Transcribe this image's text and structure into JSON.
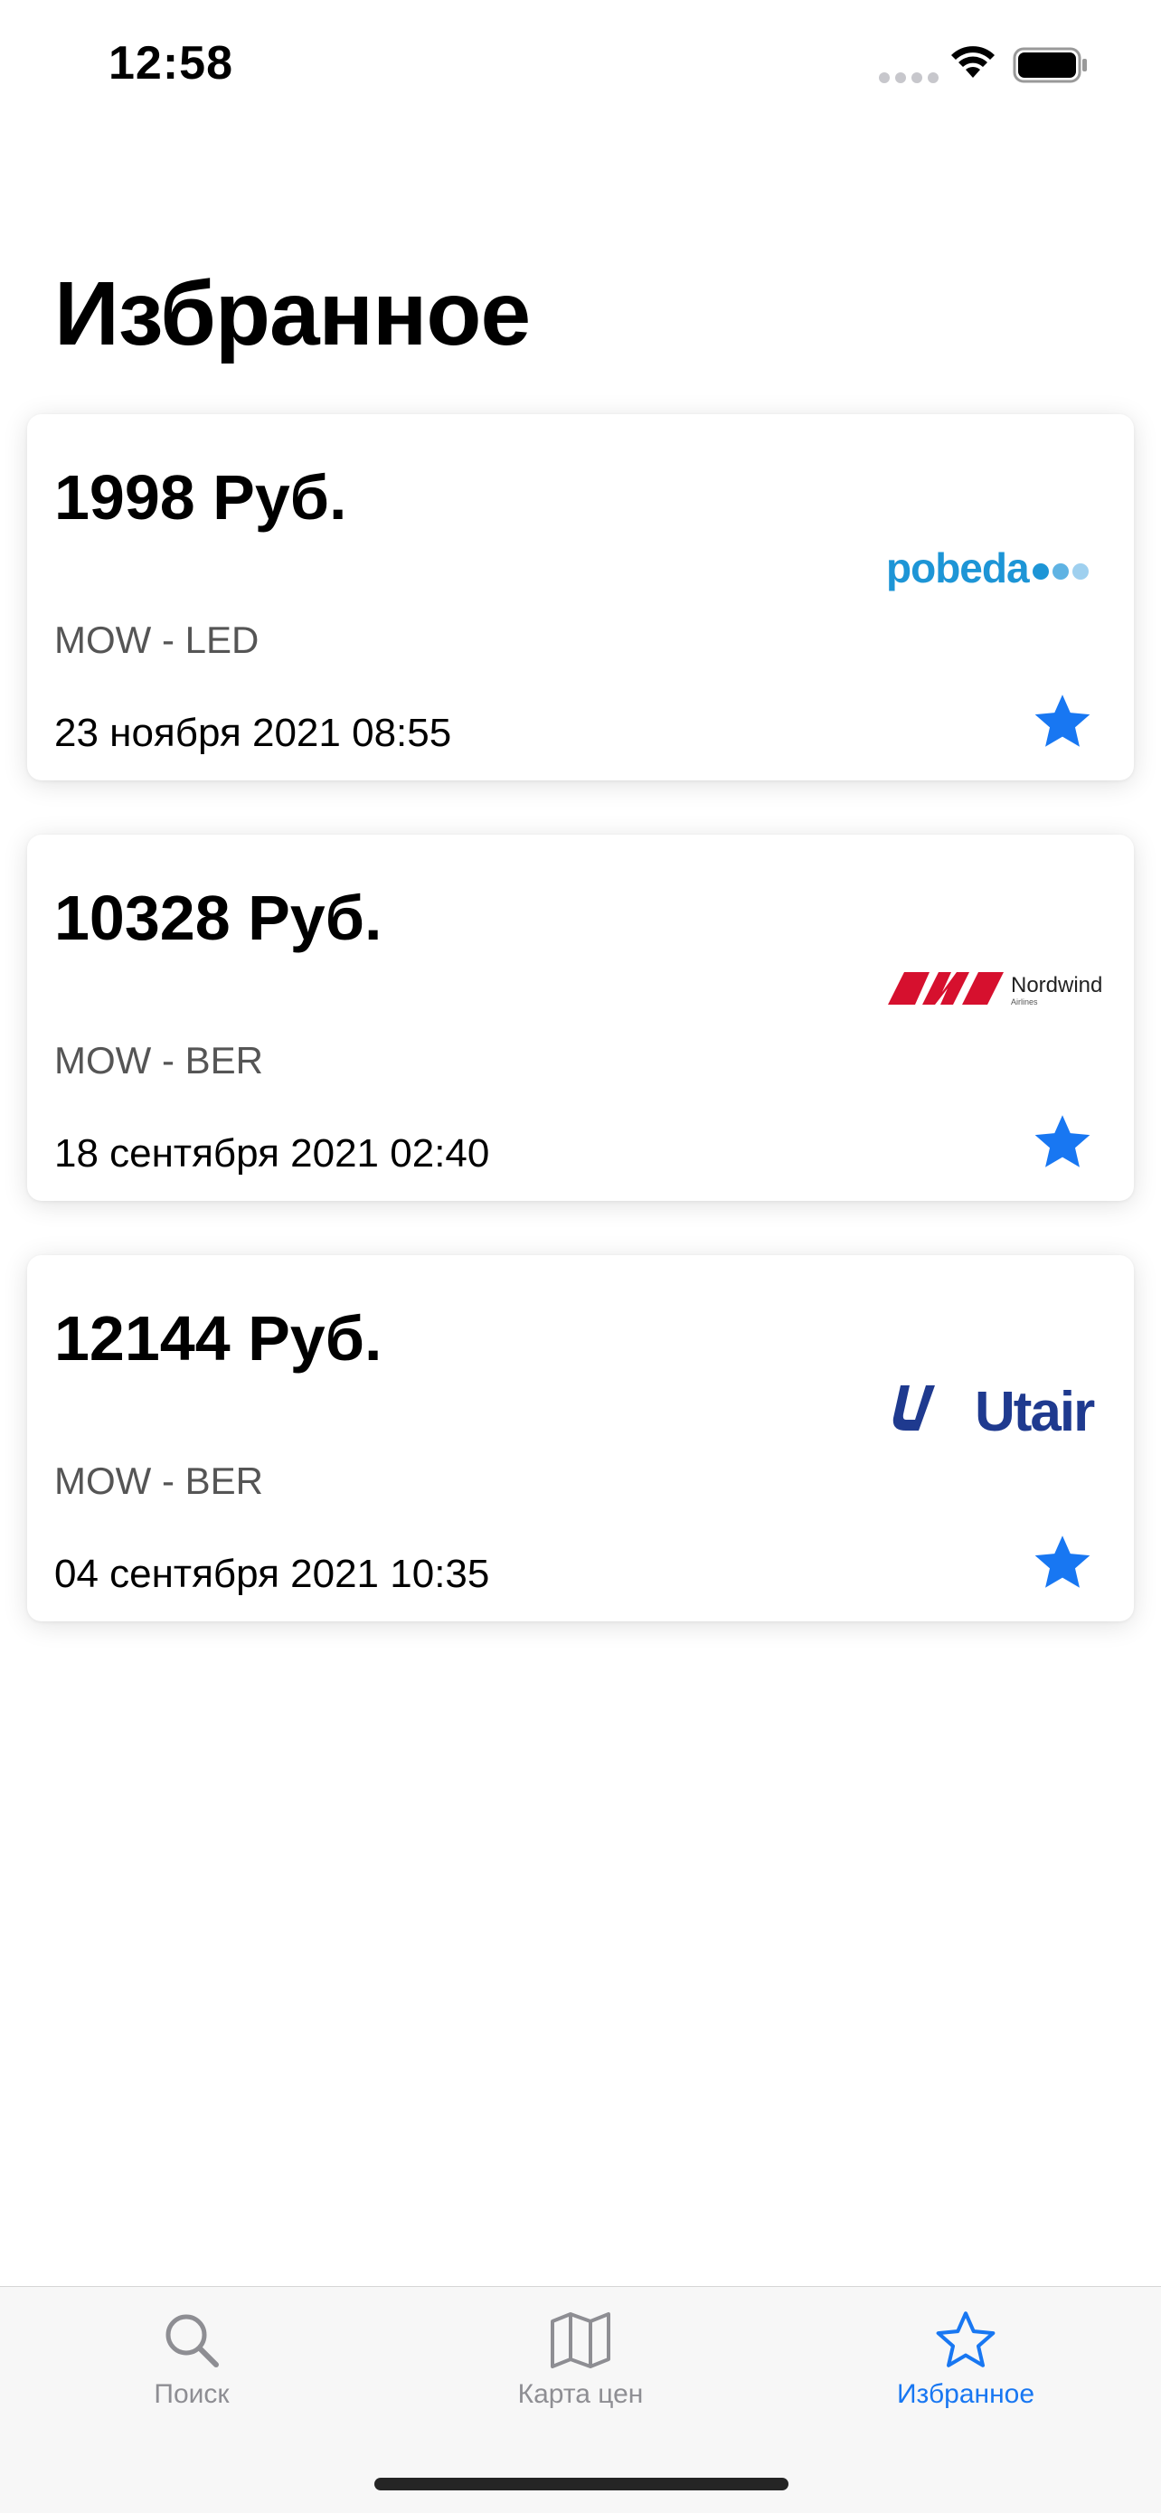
{
  "status_bar": {
    "time": "12:58"
  },
  "page": {
    "title": "Избранное"
  },
  "favorites": [
    {
      "price": "1998 Руб.",
      "route": "MOW - LED",
      "date": "23 ноября 2021 08:55",
      "airline": "pobeda",
      "logo_text": "pobeda"
    },
    {
      "price": "10328 Руб.",
      "route": "MOW - BER",
      "date": "18 сентября 2021 02:40",
      "airline": "nordwind",
      "logo_text": "Nordwind",
      "logo_subtext": "Airlines"
    },
    {
      "price": "12144 Руб.",
      "route": "MOW - BER",
      "date": "04 сентября 2021 10:35",
      "airline": "utair",
      "logo_text": "Utair"
    }
  ],
  "tab_bar": {
    "items": [
      {
        "label": "Поиск",
        "icon": "search-icon",
        "active": false
      },
      {
        "label": "Карта цен",
        "icon": "map-icon",
        "active": false
      },
      {
        "label": "Избранное",
        "icon": "star-icon",
        "active": true
      }
    ]
  },
  "colors": {
    "accent": "#1877f2",
    "pobeda_blue": "#1d95d6",
    "nordwind_red": "#d6102e",
    "utair_blue": "#1f3a8f",
    "inactive_tab": "#8e8e93"
  }
}
